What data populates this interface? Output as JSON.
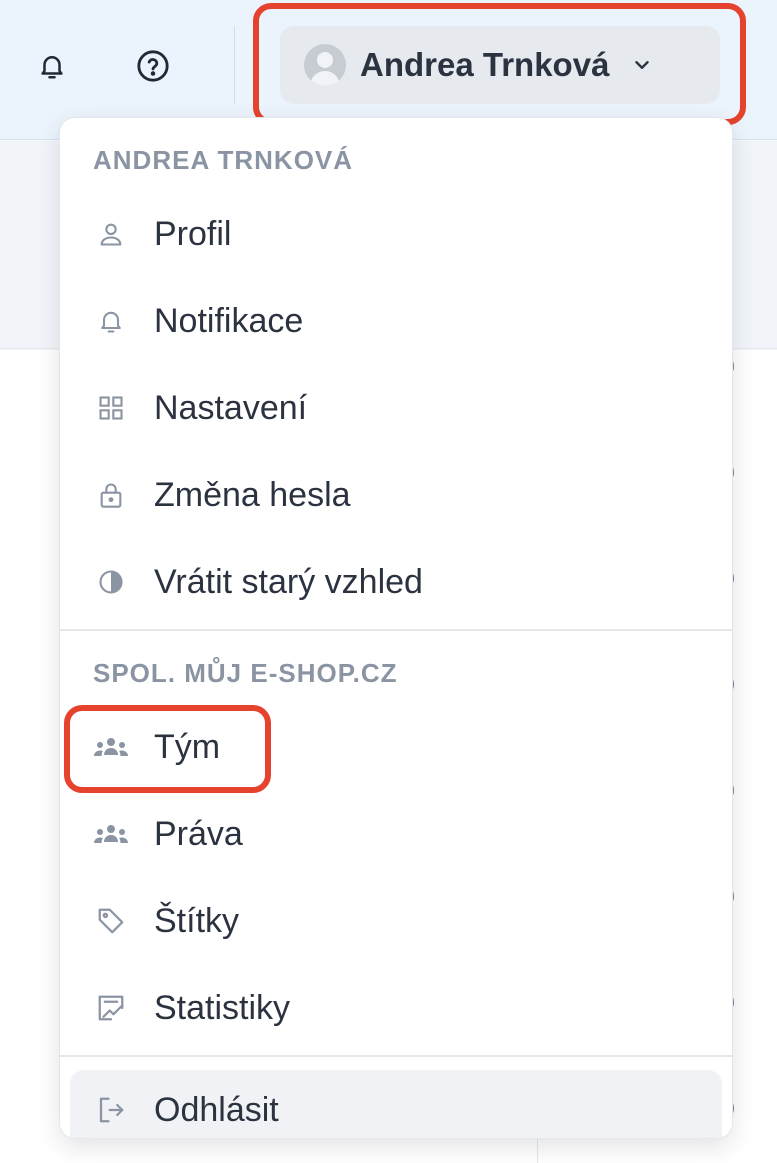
{
  "header": {
    "user_name": "Andrea Trnková",
    "icons": [
      "bell-icon",
      "help-circle-icon",
      "avatar",
      "chevron-down-icon"
    ]
  },
  "menu": {
    "user_section_title": "ANDREA TRNKOVÁ",
    "user_items": [
      {
        "label": "Profil",
        "icon": "user-icon"
      },
      {
        "label": "Notifikace",
        "icon": "bell-icon"
      },
      {
        "label": "Nastavení",
        "icon": "grid-icon"
      },
      {
        "label": "Změna hesla",
        "icon": "lock-icon"
      },
      {
        "label": "Vrátit starý vzhled",
        "icon": "contrast-icon"
      }
    ],
    "company_section_title": "SPOL. MŮJ E-SHOP.CZ",
    "company_items": [
      {
        "label": "Tým",
        "icon": "team-icon"
      },
      {
        "label": "Práva",
        "icon": "team-icon"
      },
      {
        "label": "Štítky",
        "icon": "tag-icon"
      },
      {
        "label": "Statistiky",
        "icon": "chart-icon"
      }
    ],
    "logout_label": "Odhlásit",
    "logout_icon": "logout-icon"
  },
  "background": {
    "row_marker": ")"
  },
  "colors": {
    "highlight": "#e5432d",
    "header_bg": "#ebf3fc",
    "text": "#2b3340",
    "muted": "#8a94a3"
  }
}
